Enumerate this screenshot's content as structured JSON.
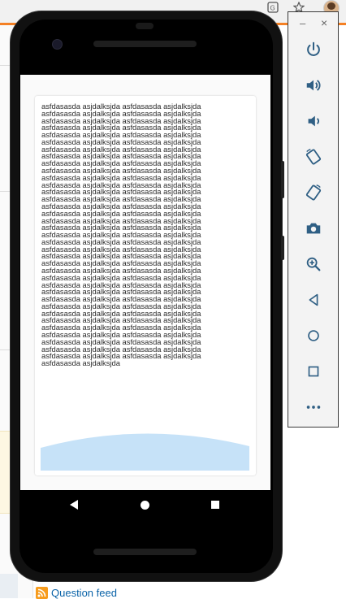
{
  "page": {
    "question_feed_label": "Question feed",
    "rss_icon": "rss-icon"
  },
  "browser": {
    "icons": [
      "translate-icon",
      "star-icon",
      "profile-avatar"
    ]
  },
  "app": {
    "content_text": "asfdasasda asjdalksjda asfdasasda asjdalksjda asfdasasda asjdalksjda asfdasasda asjdalksjda asfdasasda asjdalksjda asfdasasda asjdalksjda asfdasasda asjdalksjda asfdasasda asjdalksjda asfdasasda asjdalksjda asfdasasda asjdalksjda asfdasasda asjdalksjda asfdasasda asjdalksjda asfdasasda asjdalksjda asfdasasda asjdalksjda asfdasasda asjdalksjda asfdasasda asjdalksjda asfdasasda asjdalksjda asfdasasda asjdalksjda asfdasasda asjdalksjda asfdasasda asjdalksjda asfdasasda asjdalksjda asfdasasda asjdalksjda asfdasasda asjdalksjda asfdasasda asjdalksjda asfdasasda asjdalksjda asfdasasda asjdalksjda asfdasasda asjdalksjda asfdasasda asjdalksjda asfdasasda asjdalksjda asfdasasda asjdalksjda asfdasasda asjdalksjda asfdasasda asjdalksjda asfdasasda asjdalksjda asfdasasda asjdalksjda asfdasasda asjdalksjda asfdasasda asjdalksjda asfdasasda asjdalksjda asfdasasda asjdalksjda asfdasasda asjdalksjda asfdasasda asjdalksjda asfdasasda asjdalksjda asfdasasda asjdalksjda asfdasasda asjdalksjda asfdasasda asjdalksjda asfdasasda asjdalksjda asfdasasda asjdalksjda asfdasasda asjdalksjda asfdasasda asjdalksjda asfdasasda asjdalksjda asfdasasda asjdalksjda asfdasasda asjdalksjda asfdasasda asjdalksjda asfdasasda asjdalksjda asfdasasda asjdalksjda asfdasasda asjdalksjda asfdasasda asjdalksjda asfdasasda asjdalksjda asfdasasda asjdalksjda asfdasasda asjdalksjda asfdasasda asjdalksjda asfdasasda asjdalksjda asfdasasda asjdalksjda asfdasasda asjdalksjda asfdasasda asjdalksjda asfdasasda asjdalksjda asfdasasda asjdalksjda asfdasasda asjdalksjda asfdasasda asjdalksjda asfdasasda asjdalksjda asfdasasda asjdalksjda asfdasasda asjdalksjda asfdasasda asjdalksjda asfdasasda asjdalksjda",
    "wave_color": "#c6e2f8"
  },
  "android_nav": {
    "buttons": [
      "nav-back-icon",
      "nav-home-icon",
      "nav-recents-icon"
    ]
  },
  "emulator_toolbar": {
    "minimize_glyph": "–",
    "close_glyph": "×",
    "buttons": [
      "power-icon",
      "volume-up-icon",
      "volume-down-icon",
      "rotate-left-icon",
      "rotate-right-icon",
      "camera-icon",
      "zoom-icon",
      "back-icon",
      "home-icon",
      "overview-icon",
      "more-icon"
    ],
    "icon_color": "#2f5f84"
  },
  "colors": {
    "accent_orange": "#f48024",
    "link_blue": "#0a63a8"
  }
}
